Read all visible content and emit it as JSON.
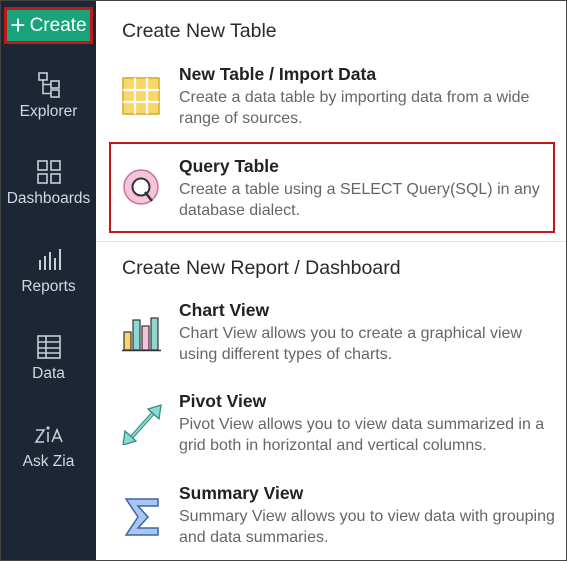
{
  "sidebar": {
    "create_label": "Create",
    "items": [
      {
        "label": "Explorer",
        "icon": "explorer-icon"
      },
      {
        "label": "Dashboards",
        "icon": "dashboards-icon"
      },
      {
        "label": "Reports",
        "icon": "reports-icon"
      },
      {
        "label": "Data",
        "icon": "data-icon"
      },
      {
        "label": "Ask Zia",
        "icon": "ask-zia-icon"
      }
    ]
  },
  "tables_section": {
    "title": "Create New Table",
    "items": [
      {
        "title": "New Table / Import Data",
        "desc": "Create a data table by importing data from a wide range of sources.",
        "icon": "grid-table-icon"
      },
      {
        "title": "Query Table",
        "desc": "Create a table using a SELECT Query(SQL) in any database dialect.",
        "icon": "query-icon"
      }
    ]
  },
  "reports_section": {
    "title": "Create New Report / Dashboard",
    "items": [
      {
        "title": "Chart View",
        "desc": "Chart View allows you to create a graphical view using different types of charts.",
        "icon": "bar-chart-icon"
      },
      {
        "title": "Pivot View",
        "desc": "Pivot View allows you to view data summarized in a grid both in horizontal and vertical columns.",
        "icon": "pivot-arrows-icon"
      },
      {
        "title": "Summary View",
        "desc": "Summary View allows you to view data with grouping and data summaries.",
        "icon": "sigma-icon"
      }
    ]
  },
  "colors": {
    "sidebar_bg": "#1c2634",
    "create_bg": "#1aa37a",
    "highlight": "#c01818"
  }
}
